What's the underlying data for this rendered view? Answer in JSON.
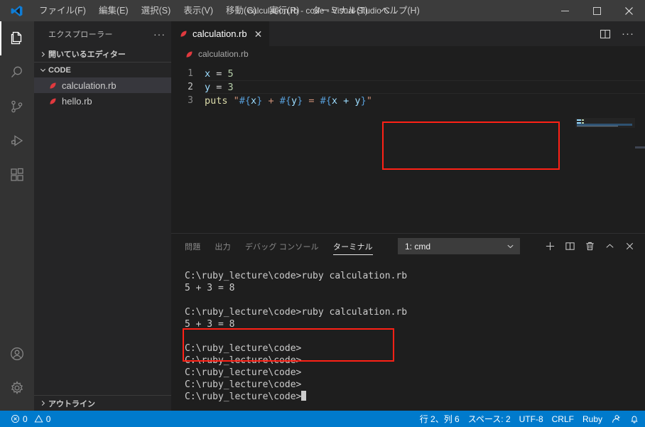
{
  "titlebar": {
    "logo_icon": "vscode-logo-icon",
    "menus": [
      {
        "label": "ファイル(F)",
        "name": "menu-file"
      },
      {
        "label": "編集(E)",
        "name": "menu-edit"
      },
      {
        "label": "選択(S)",
        "name": "menu-selection"
      },
      {
        "label": "表示(V)",
        "name": "menu-view"
      },
      {
        "label": "移動(G)",
        "name": "menu-go"
      },
      {
        "label": "実行(R)",
        "name": "menu-run"
      },
      {
        "label": "ターミナル(T)",
        "name": "menu-terminal"
      },
      {
        "label": "ヘルプ(H)",
        "name": "menu-help"
      }
    ],
    "window_title": "calculation.rb - code - Visual Studio C...",
    "minimize": "—",
    "maximize": "☐",
    "close": "✕"
  },
  "activitybar": {
    "items": [
      {
        "icon": "files-explorer-icon",
        "active": true
      },
      {
        "icon": "search-icon",
        "active": false
      },
      {
        "icon": "source-control-icon",
        "active": false
      },
      {
        "icon": "run-and-debug-icon",
        "active": false
      },
      {
        "icon": "extensions-icon",
        "active": false
      }
    ],
    "bottom_items": [
      {
        "icon": "account-icon"
      },
      {
        "icon": "settings-gear-icon"
      }
    ]
  },
  "sidebar": {
    "title": "エクスプローラー",
    "more_actions": "···",
    "open_editors_label": "開いているエディター",
    "folder_label": "CODE",
    "files": [
      {
        "name": "calculation.rb",
        "selected": true
      },
      {
        "name": "hello.rb",
        "selected": false
      }
    ],
    "outline_label": "アウトライン"
  },
  "editor": {
    "tab_label": "calculation.rb",
    "tab_close": "✕",
    "breadcrumb": "calculation.rb",
    "actions": [
      {
        "icon": "split-editor-icon"
      },
      {
        "icon": "more-actions-icon",
        "label": "···"
      }
    ],
    "line_numbers": [
      "1",
      "2",
      "3"
    ],
    "code": {
      "line1": {
        "var": "x",
        "op": " = ",
        "num": "5"
      },
      "line2": {
        "var": "y",
        "op": " = ",
        "num": "3"
      },
      "line3": {
        "kw": "puts",
        "quote_open": " \"",
        "i1_open": "#{",
        "i1_var": "x",
        "i1_close": "}",
        "plus": " + ",
        "i2_open": "#{",
        "i2_var": "y",
        "i2_close": "}",
        "eq": " = ",
        "i3_open": "#{",
        "i3_expr": "x + y",
        "i3_close": "}",
        "quote_close": "\""
      }
    },
    "highlight_color": "#ff2116"
  },
  "panel": {
    "tabs": [
      {
        "label": "問題",
        "active": false
      },
      {
        "label": "出力",
        "active": false
      },
      {
        "label": "デバッグ コンソール",
        "active": false
      },
      {
        "label": "ターミナル",
        "active": true
      }
    ],
    "terminal_select": {
      "value": "1: cmd",
      "chevron": "⌄"
    },
    "actions": [
      {
        "icon": "new-terminal-plus-icon"
      },
      {
        "icon": "split-terminal-icon"
      },
      {
        "icon": "kill-terminal-trash-icon"
      },
      {
        "icon": "maximize-panel-chevron-up-icon"
      },
      {
        "icon": "close-panel-icon"
      }
    ],
    "terminal_lines": [
      "C:\\ruby_lecture\\code>ruby calculation.rb",
      "5 + 3 = 8",
      "",
      "C:\\ruby_lecture\\code>ruby calculation.rb",
      "5 + 3 = 8",
      "",
      "C:\\ruby_lecture\\code>",
      "C:\\ruby_lecture\\code>",
      "C:\\ruby_lecture\\code>",
      "C:\\ruby_lecture\\code>"
    ],
    "terminal_prompt_last": "C:\\ruby_lecture\\code>"
  },
  "statusbar": {
    "error_icon": "error-circle-icon",
    "error_count": "0",
    "warning_icon": "warning-triangle-icon",
    "warning_count": "0",
    "cursor_position": "行 2、列 6",
    "indentation": "スペース: 2",
    "encoding": "UTF-8",
    "eol": "CRLF",
    "language": "Ruby",
    "feedback_icon": "feedback-smiley-icon",
    "bell_icon": "notifications-bell-icon",
    "accent_color": "#007acc"
  }
}
